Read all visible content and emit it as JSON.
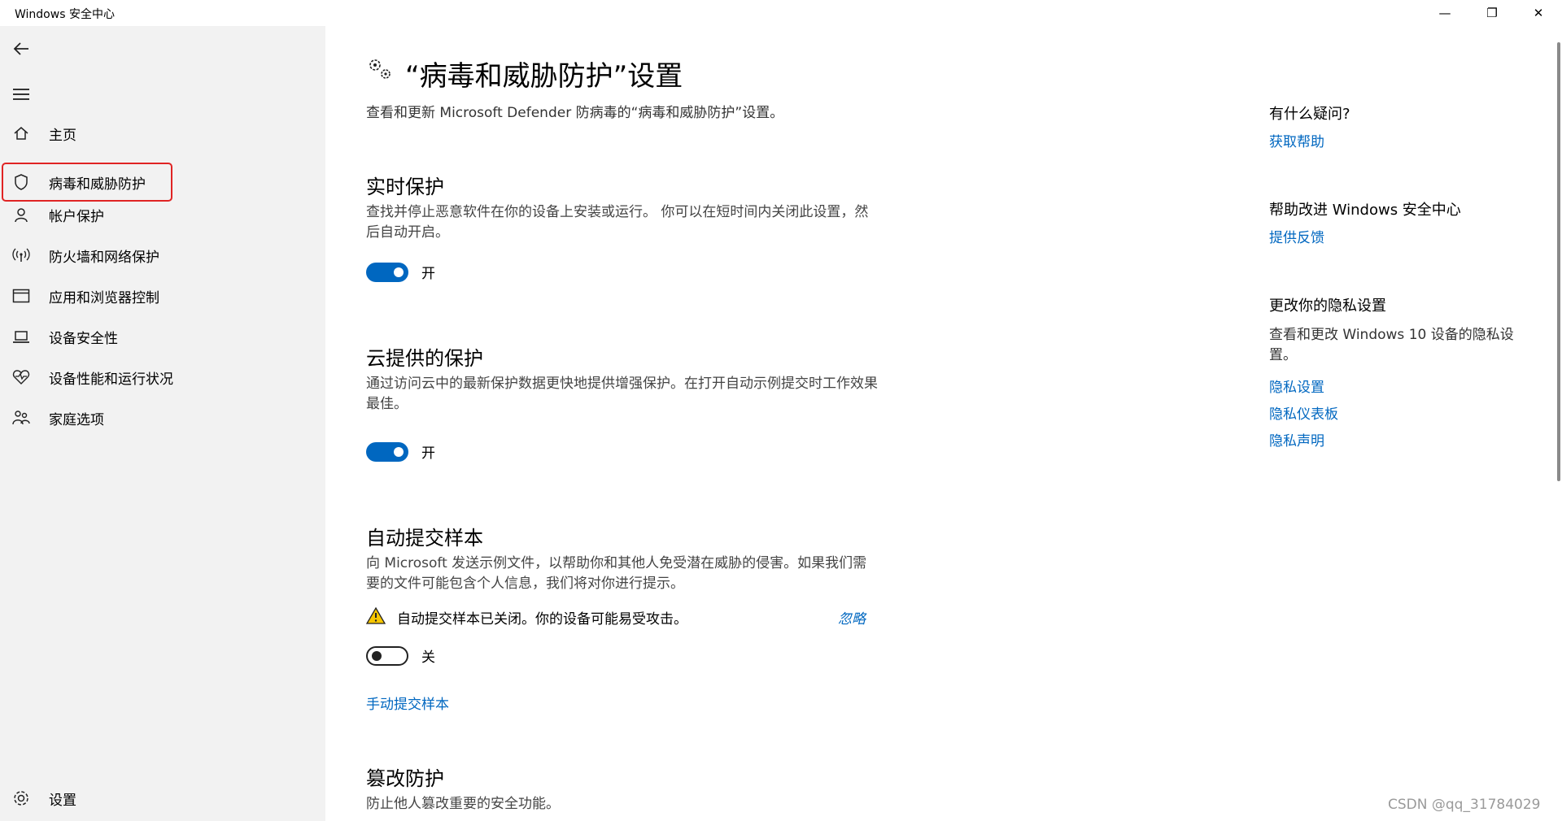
{
  "window": {
    "title": "Windows 安全中心",
    "minimize": "—",
    "maximize": "❐",
    "close": "✕"
  },
  "sidebar": {
    "back_icon": "back-arrow-icon",
    "menu_icon": "hamburger-icon",
    "items": [
      {
        "label": "主页",
        "icon": "home-icon"
      },
      {
        "label": "病毒和威胁防护",
        "icon": "shield-icon",
        "selected": true
      },
      {
        "label": "帐户保护",
        "icon": "person-icon"
      },
      {
        "label": "防火墙和网络保护",
        "icon": "antenna-icon"
      },
      {
        "label": "应用和浏览器控制",
        "icon": "browser-window-icon"
      },
      {
        "label": "设备安全性",
        "icon": "laptop-icon"
      },
      {
        "label": "设备性能和运行状况",
        "icon": "heart-pulse-icon"
      },
      {
        "label": "家庭选项",
        "icon": "family-icon"
      }
    ],
    "settings": {
      "label": "设置",
      "icon": "gear-icon"
    }
  },
  "main": {
    "title": "“病毒和威胁防护”设置",
    "description": "查看和更新 Microsoft Defender 防病毒的“病毒和威胁防护”设置。",
    "realtime": {
      "heading": "实时保护",
      "description": "查找并停止恶意软件在你的设备上安装或运行。 你可以在短时间内关闭此设置，然后自动开启。",
      "toggle_label": "开",
      "on": true
    },
    "cloud": {
      "heading": "云提供的保护",
      "description": "通过访问云中的最新保护数据更快地提供增强保护。在打开自动示例提交时工作效果最佳。",
      "toggle_label": "开",
      "on": true
    },
    "sample": {
      "heading": "自动提交样本",
      "description": "向 Microsoft 发送示例文件，以帮助你和其他人免受潜在威胁的侵害。如果我们需要的文件可能包含个人信息，我们将对你进行提示。",
      "warning": "自动提交样本已关闭。你的设备可能易受攻击。",
      "dismiss": "忽略",
      "toggle_label": "关",
      "on": false,
      "manual_link": "手动提交样本"
    },
    "tamper": {
      "heading": "篡改防护",
      "description": "防止他人篡改重要的安全功能。"
    }
  },
  "right": {
    "question_heading": "有什么疑问?",
    "get_help": "获取帮助",
    "improve_heading": "帮助改进 Windows 安全中心",
    "feedback": "提供反馈",
    "privacy_heading": "更改你的隐私设置",
    "privacy_text": "查看和更改 Windows 10 设备的隐私设置。",
    "privacy_settings": "隐私设置",
    "privacy_dashboard": "隐私仪表板",
    "privacy_statement": "隐私声明"
  },
  "watermark": "CSDN @qq_31784029",
  "colors": {
    "accent": "#0067c0",
    "highlight": "#e02424",
    "sidebar_bg": "#f2f2f2"
  }
}
